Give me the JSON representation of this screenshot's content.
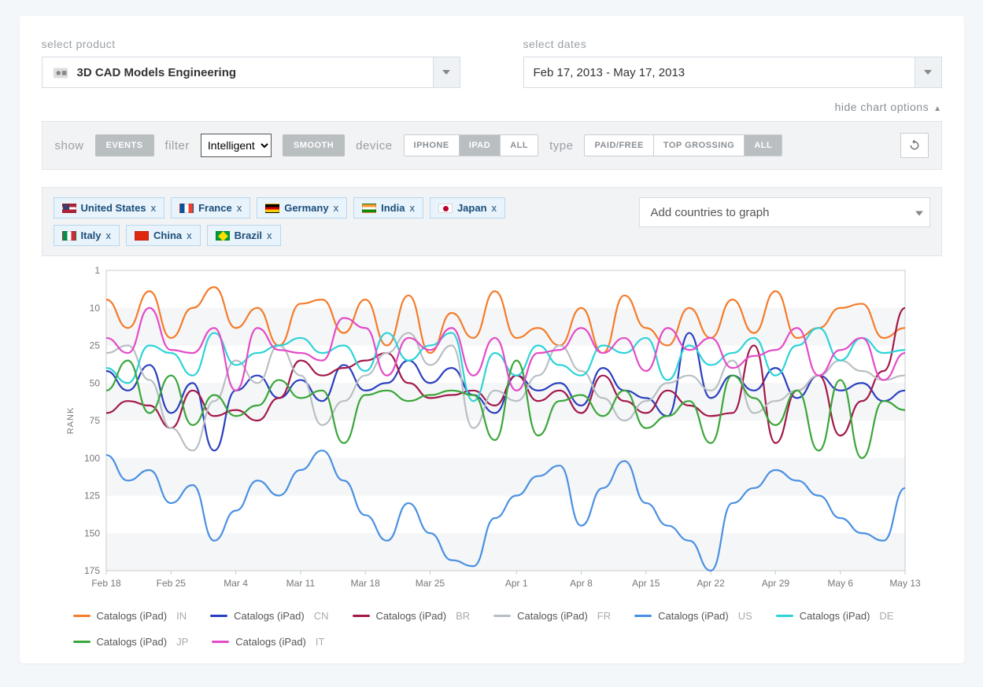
{
  "selectors": {
    "product_label": "select product",
    "product_value": "3D CAD Models Engineering",
    "dates_label": "select dates",
    "dates_value": "Feb 17, 2013 - May 17, 2013"
  },
  "hide_chart_options": "hide chart options",
  "options": {
    "show_label": "show",
    "events_btn": "EVENTS",
    "filter_label": "filter",
    "filter_value": "Intelligent",
    "smooth_btn": "SMOOTH",
    "device_label": "device",
    "device_opts": [
      "IPHONE",
      "IPAD",
      "ALL"
    ],
    "device_selected": "IPAD",
    "type_label": "type",
    "type_opts": [
      "PAID/FREE",
      "TOP GROSSING",
      "ALL"
    ],
    "type_selected": "ALL"
  },
  "countries": [
    {
      "name": "United States",
      "cc": "US",
      "flag": "us"
    },
    {
      "name": "France",
      "cc": "FR",
      "flag": "fr"
    },
    {
      "name": "Germany",
      "cc": "DE",
      "flag": "de"
    },
    {
      "name": "India",
      "cc": "IN",
      "flag": "in"
    },
    {
      "name": "Japan",
      "cc": "JP",
      "flag": "jp"
    },
    {
      "name": "Italy",
      "cc": "IT",
      "flag": "it"
    },
    {
      "name": "China",
      "cc": "CN",
      "flag": "cn"
    },
    {
      "name": "Brazil",
      "cc": "BR",
      "flag": "br"
    }
  ],
  "add_country_placeholder": "Add countries to graph",
  "chart_data": {
    "type": "line",
    "ylabel": "RANK",
    "yticks": [
      1,
      10,
      25,
      50,
      75,
      100,
      125,
      150,
      175
    ],
    "ylim": [
      175,
      1
    ],
    "x_categories": [
      "Feb 18",
      "Feb 25",
      "Mar 4",
      "Mar 11",
      "Mar 18",
      "Mar 25",
      "Apr 1",
      "Apr 8",
      "Apr 15",
      "Apr 22",
      "Apr 29",
      "May 6",
      "May 13"
    ],
    "series": [
      {
        "name": "Catalogs (iPad)",
        "cc": "IN",
        "color": "#f47c2b",
        "values": [
          8,
          18,
          6,
          22,
          10,
          5,
          18,
          10,
          25,
          9,
          8,
          20,
          8,
          25,
          7,
          30,
          12,
          22,
          6,
          22,
          18,
          25,
          10,
          30,
          7,
          18,
          25,
          10,
          22,
          8,
          20,
          6,
          22,
          18,
          10,
          9,
          22,
          18
        ]
      },
      {
        "name": "Catalogs (iPad)",
        "cc": "CN",
        "color": "#2a3fbf",
        "values": [
          42,
          55,
          38,
          70,
          50,
          95,
          55,
          45,
          60,
          48,
          62,
          38,
          55,
          50,
          35,
          50,
          40,
          58,
          70,
          45,
          55,
          50,
          65,
          40,
          55,
          60,
          72,
          20,
          60,
          45,
          55,
          40,
          60,
          45,
          55,
          50,
          62,
          55
        ]
      },
      {
        "name": "Catalogs (iPad)",
        "cc": "BR",
        "color": "#a3184a",
        "values": [
          70,
          62,
          65,
          80,
          55,
          72,
          68,
          75,
          60,
          35,
          45,
          40,
          35,
          30,
          50,
          60,
          58,
          55,
          65,
          45,
          62,
          55,
          70,
          45,
          62,
          70,
          55,
          65,
          72,
          70,
          25,
          90,
          55,
          45,
          85,
          62,
          42,
          10
        ]
      },
      {
        "name": "Catalogs (iPad)",
        "cc": "FR",
        "color": "#b8bfc4",
        "values": [
          30,
          25,
          48,
          80,
          95,
          62,
          35,
          50,
          25,
          45,
          78,
          62,
          45,
          30,
          20,
          38,
          25,
          80,
          55,
          62,
          45,
          25,
          42,
          60,
          75,
          62,
          50,
          45,
          55,
          35,
          70,
          62,
          55,
          45,
          35,
          42,
          48,
          45
        ]
      },
      {
        "name": "Catalogs (iPad)",
        "cc": "US",
        "color": "#4a90e2",
        "values": [
          98,
          115,
          108,
          130,
          118,
          155,
          135,
          115,
          125,
          108,
          95,
          115,
          138,
          155,
          130,
          150,
          168,
          172,
          140,
          125,
          112,
          105,
          145,
          120,
          102,
          130,
          145,
          155,
          175,
          130,
          120,
          108,
          115,
          125,
          140,
          150,
          155,
          120
        ]
      },
      {
        "name": "Catalogs (iPad)",
        "cc": "DE",
        "color": "#2dd3d8",
        "values": [
          40,
          50,
          25,
          30,
          45,
          20,
          38,
          30,
          25,
          22,
          30,
          25,
          42,
          20,
          35,
          25,
          20,
          62,
          30,
          45,
          25,
          38,
          45,
          25,
          30,
          22,
          48,
          25,
          38,
          30,
          22,
          45,
          25,
          18,
          35,
          22,
          30,
          28
        ]
      },
      {
        "name": "Catalogs (iPad)",
        "cc": "JP",
        "color": "#3aa63a",
        "values": [
          55,
          35,
          70,
          45,
          78,
          58,
          72,
          65,
          48,
          60,
          55,
          90,
          58,
          55,
          62,
          58,
          55,
          58,
          88,
          35,
          85,
          62,
          58,
          72,
          55,
          80,
          72,
          62,
          90,
          45,
          60,
          78,
          55,
          95,
          48,
          100,
          62,
          68
        ]
      },
      {
        "name": "Catalogs (iPad)",
        "cc": "IT",
        "color": "#e34bc8",
        "values": [
          22,
          30,
          10,
          28,
          30,
          18,
          55,
          18,
          28,
          30,
          35,
          14,
          18,
          45,
          22,
          28,
          18,
          45,
          22,
          55,
          30,
          28,
          18,
          30,
          22,
          42,
          18,
          28,
          22,
          40,
          32,
          28,
          18,
          45,
          28,
          22,
          48,
          30
        ]
      }
    ]
  }
}
